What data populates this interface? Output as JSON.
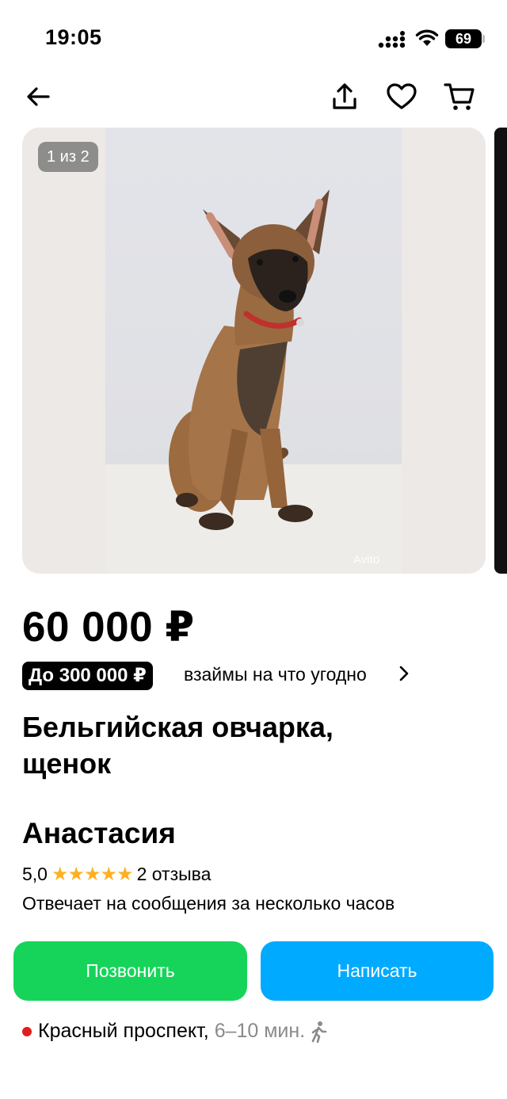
{
  "status_bar": {
    "time": "19:05",
    "battery": "69"
  },
  "gallery": {
    "counter": "1 из 2",
    "watermark": "Avito"
  },
  "listing": {
    "price": "60 000 ₽",
    "loan_badge": "До 300 000 ₽",
    "loan_text": "взаймы на что угодно",
    "title_line1": "Бельгийская овчарка,",
    "title_line2": "щенок"
  },
  "seller": {
    "name": "Анастасия",
    "rating": "5,0",
    "stars": "★★★★★",
    "reviews": "2 отзыва",
    "reply_time": "Отвечает на сообщения за несколько часов"
  },
  "actions": {
    "call_label": "Позвонить",
    "write_label": "Написать"
  },
  "location": {
    "station": "Красный проспект,",
    "walk_time": "6–10 мин."
  },
  "icons": [
    "back-icon",
    "share-icon",
    "heart-icon",
    "cart-icon",
    "walking-icon",
    "star-icon"
  ],
  "colors": {
    "call": "#16d45a",
    "write": "#00aaff",
    "star": "#ffb021",
    "metro": "#e01e1e"
  }
}
